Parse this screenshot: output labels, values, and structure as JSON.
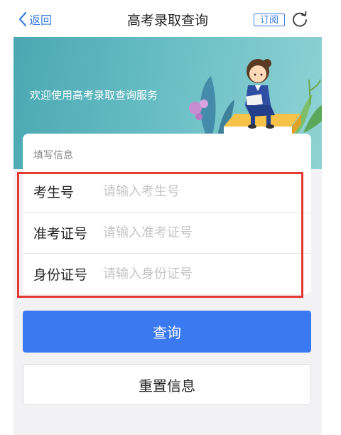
{
  "nav": {
    "back_label": "返回",
    "title": "高考录取查询",
    "subscribe_label": "订阅"
  },
  "banner": {
    "text": "欢迎使用高考录取查询服务"
  },
  "form": {
    "section_title": "填写信息",
    "fields": [
      {
        "label": "考生号",
        "placeholder": "请输入考生号",
        "value": ""
      },
      {
        "label": "准考证号",
        "placeholder": "请输入准考证号",
        "value": ""
      },
      {
        "label": "身份证号",
        "placeholder": "请输入身份证号",
        "value": ""
      }
    ]
  },
  "buttons": {
    "query_label": "查询",
    "reset_label": "重置信息"
  },
  "colors": {
    "accent": "#3b79f1",
    "link": "#3a7be0",
    "highlight": "#e53935",
    "banner": "#6dc1c7"
  }
}
